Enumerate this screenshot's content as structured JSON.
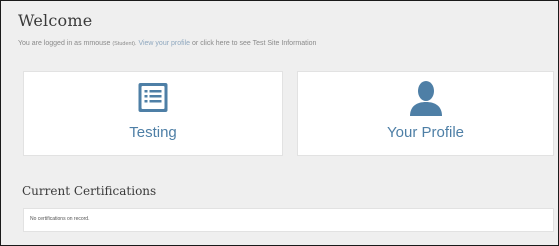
{
  "header": {
    "title": "Welcome",
    "login_prefix": "You are logged in as",
    "username": "mmouse",
    "role": "(Student).",
    "profile_link": "View your profile",
    "or_text": "or",
    "site_info_link": "click here to see Test Site Information"
  },
  "tiles": [
    {
      "label": "Testing",
      "icon": "list-icon"
    },
    {
      "label": "Your Profile",
      "icon": "user-icon"
    }
  ],
  "certifications": {
    "title": "Current Certifications",
    "empty_message": "No certifications on record."
  },
  "colors": {
    "accent": "#4e7fa6",
    "background": "#efefef",
    "panel": "#ffffff"
  }
}
